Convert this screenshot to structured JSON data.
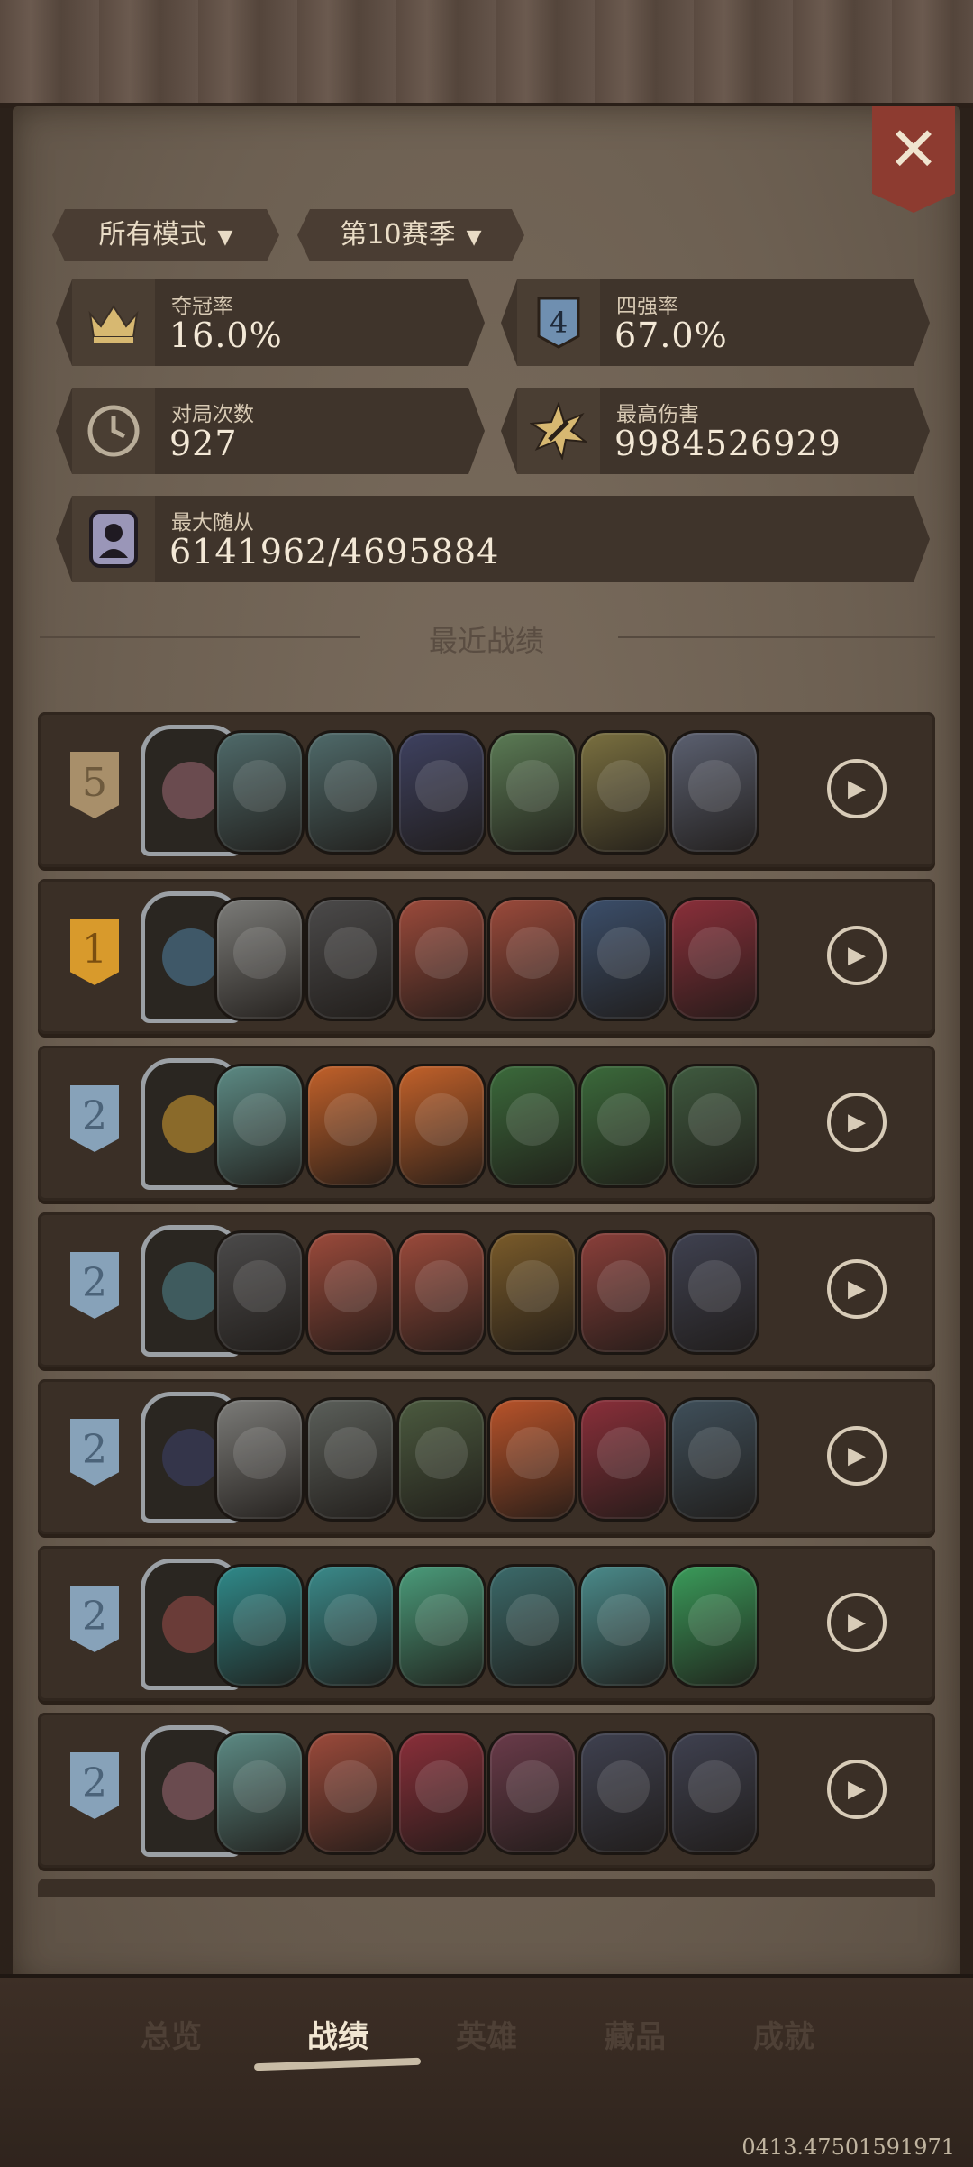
{
  "filters": {
    "mode": "所有模式",
    "season": "第10赛季"
  },
  "stats": {
    "win_rate": {
      "label": "夺冠率",
      "value": "16.0%"
    },
    "top4_rate": {
      "label": "四强率",
      "value": "67.0%"
    },
    "games": {
      "label": "对局次数",
      "value": "927"
    },
    "max_damage": {
      "label": "最高伤害",
      "value": "9984526929"
    },
    "max_minion": {
      "label": "最大随从",
      "value": "6141962/4695884"
    }
  },
  "section_title": "最近战绩",
  "top4_badge": "4",
  "matches": [
    {
      "rank": "5",
      "rank_style": "bronze",
      "hero_color": "#6a4b4f",
      "minions": [
        "#4f6a6a",
        "#4f6a6a",
        "#3e4160",
        "#5b7b55",
        "#7a7040",
        "#5b6070"
      ]
    },
    {
      "rank": "1",
      "rank_style": "gold",
      "hero_color": "#3f5868",
      "minions": [
        "#7b7b78",
        "#4b4a4a",
        "#9b4a3b",
        "#9b4a3b",
        "#3b4e6a",
        "#8a2f3a"
      ]
    },
    {
      "rank": "2",
      "rank_style": "silver",
      "hero_color": "#8a6a2a",
      "minions": [
        "#5c8a84",
        "#c2612a",
        "#c2612a",
        "#3b6a3b",
        "#3b6a3b",
        "#3f5a3f"
      ]
    },
    {
      "rank": "2",
      "rank_style": "silver",
      "hero_color": "#3f5b5e",
      "minions": [
        "#4b4a4a",
        "#9b4a3b",
        "#9b4a3b",
        "#7a5b2a",
        "#8a3f3a",
        "#3f4150"
      ]
    },
    {
      "rank": "2",
      "rank_style": "silver",
      "hero_color": "#34354a",
      "minions": [
        "#7b7b78",
        "#5b5f5a",
        "#4b5a3f",
        "#b8532a",
        "#8a2f3a",
        "#3f4f5a"
      ]
    },
    {
      "rank": "2",
      "rank_style": "silver",
      "hero_color": "#6a3c38",
      "minions": [
        "#2f8a8a",
        "#3a8a8a",
        "#4a9b7a",
        "#3b6a6a",
        "#4a8a8a",
        "#3a9b5a"
      ]
    },
    {
      "rank": "2",
      "rank_style": "silver",
      "hero_color": "#6a4b4f",
      "minions": [
        "#5c8a84",
        "#9b4a3b",
        "#8a2f3a",
        "#6a3b4a",
        "#3f4150",
        "#3f4150"
      ]
    }
  ],
  "nav": {
    "overview": "总览",
    "records": "战绩",
    "heroes": "英雄",
    "collection": "藏品",
    "achievements": "成就"
  },
  "footer_id": "0413.47501591971"
}
